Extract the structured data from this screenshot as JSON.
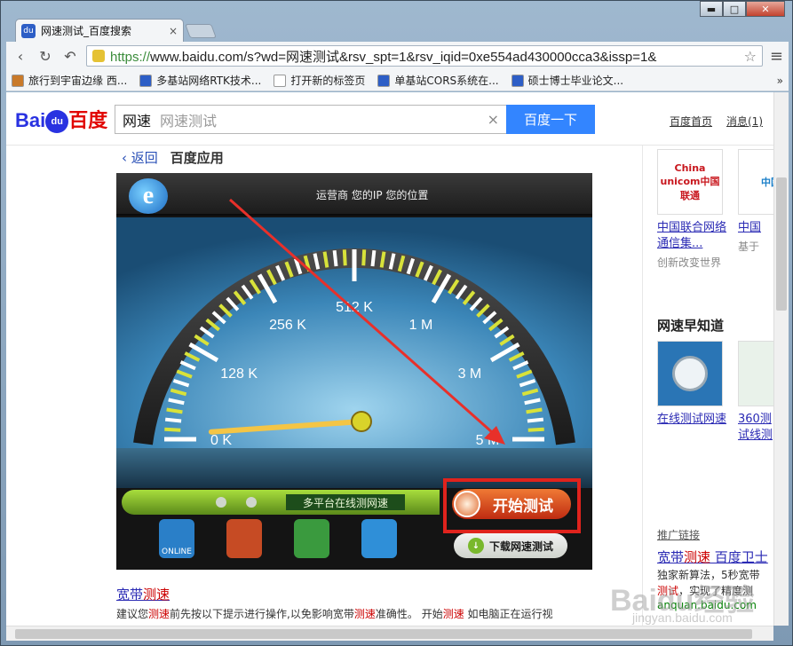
{
  "window": {
    "minimize": "▬",
    "maximize": "□",
    "close": "✕"
  },
  "tab": {
    "title": "网速测试_百度搜索",
    "close": "×"
  },
  "toolbar": {
    "url_protocol": "https://",
    "url_rest": "www.baidu.com/s?wd=网速测试&rsv_spt=1&rsv_iqid=0xe554ad430000cca3&issp=1&"
  },
  "bookmarks": [
    {
      "label": "旅行到宇宙边缘 西...",
      "color": "#c97a2a"
    },
    {
      "label": "多基站网络RTK技术...",
      "color": "#2d5ec6"
    },
    {
      "label": "打开新的标签页",
      "color": "#ffffff"
    },
    {
      "label": "单基站CORS系统在...",
      "color": "#2d5ec6"
    },
    {
      "label": "硕士博士毕业论文...",
      "color": "#2d5ec6"
    }
  ],
  "bookmarks_more": "»",
  "header": {
    "logo_left": "Bai",
    "logo_paw": "du",
    "logo_right": "百度",
    "search_value": "网速",
    "search_placeholder": "网速测试",
    "search_button": "百度一下",
    "home_link": "百度首页",
    "messages_link": "消息(1)"
  },
  "subhead": {
    "back": "‹ 返回",
    "app_title": "百度应用"
  },
  "speedtest": {
    "info": "运营商  您的IP  您的位置",
    "ticks": [
      "0 K",
      "128 K",
      "256 K",
      "512 K",
      "1 M",
      "3 M",
      "5 M"
    ],
    "needle_tick": "0 K",
    "platform_label": "多平台在线测网速",
    "start_button": "开始测试",
    "download_button": "下载网速测试",
    "app_icons": [
      {
        "label": "ONLINE",
        "color": "#2a7fc8"
      },
      {
        "label": "",
        "color": "#c64b24"
      },
      {
        "label": "",
        "color": "#3a9a3e"
      },
      {
        "label": "",
        "color": "#2f8fd8"
      }
    ]
  },
  "result": {
    "title_a": "宽带",
    "title_b": "测速",
    "snippet_parts": [
      "建议您",
      "测速",
      "前先按以下提示进行操作,以免影响宽带",
      "测速",
      "准确性。 开始",
      "测速",
      " 如电脑正在运行视"
    ]
  },
  "right": {
    "cards": [
      {
        "thumb": "China unicom中国联通",
        "title": "中国联合网络通信集...",
        "desc": "创新改变世界"
      },
      {
        "thumb": "中国",
        "title": "中国",
        "desc": "基于"
      }
    ],
    "section_title": "网速早知道",
    "cards2": [
      {
        "title": "在线测试网速"
      },
      {
        "title": "360测试线测"
      }
    ],
    "promo_label": "推广链接",
    "promo_title_a": "宽带",
    "promo_title_b": "测速",
    "promo_title_c": " 百度卫士",
    "promo_line1": "独家新算法，5秒宽带",
    "promo_line2_a": "测试",
    "promo_line2_b": "，实现了精度测",
    "promo_url": "anquan.baidu.com"
  },
  "watermark": "Baidu经验",
  "watermark_sub": "jingyan.baidu.com"
}
